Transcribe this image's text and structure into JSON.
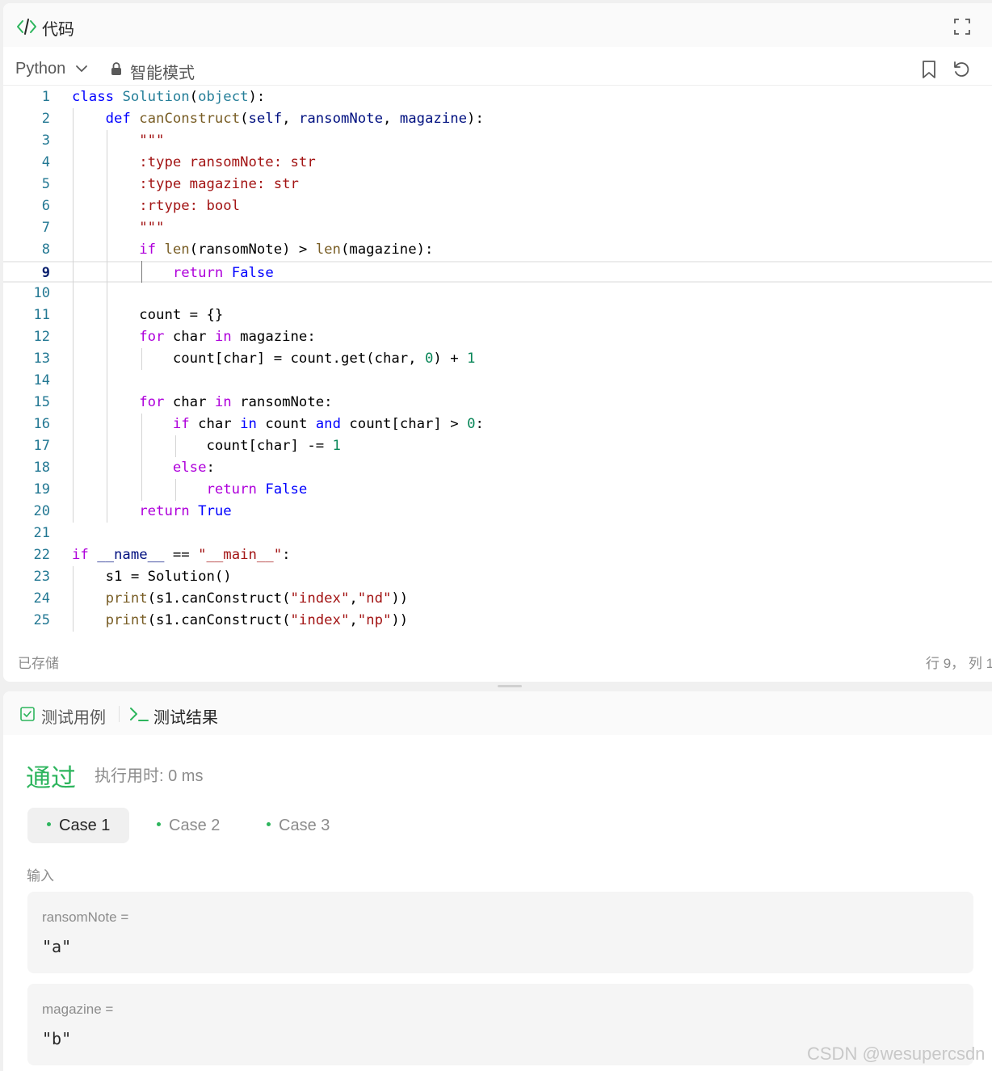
{
  "code_panel": {
    "title": "代码",
    "icon": "code-brackets-icon",
    "expand_icon": "fullscreen-icon",
    "language": "Python",
    "mode_label": "智能模式",
    "saved_label": "已存储",
    "cursor_label": "行 9， 列 1"
  },
  "editor": {
    "current_line": 9,
    "lines": [
      {
        "n": "1",
        "indent": 0,
        "tokens": [
          {
            "t": "class",
            "c": "kw"
          },
          {
            "t": " "
          },
          {
            "t": "Solution",
            "c": "cls"
          },
          {
            "t": "("
          },
          {
            "t": "object",
            "c": "cls"
          },
          {
            "t": "):"
          }
        ]
      },
      {
        "n": "2",
        "indent": 1,
        "tokens": [
          {
            "t": "def",
            "c": "kw"
          },
          {
            "t": " "
          },
          {
            "t": "canConstruct",
            "c": "fn"
          },
          {
            "t": "("
          },
          {
            "t": "self",
            "c": "prm"
          },
          {
            "t": ", "
          },
          {
            "t": "ransomNote",
            "c": "prm"
          },
          {
            "t": ", "
          },
          {
            "t": "magazine",
            "c": "prm"
          },
          {
            "t": "):"
          }
        ]
      },
      {
        "n": "3",
        "indent": 2,
        "tokens": [
          {
            "t": "\"\"\"",
            "c": "str"
          }
        ]
      },
      {
        "n": "4",
        "indent": 2,
        "tokens": [
          {
            "t": ":type ransomNote: str",
            "c": "str"
          }
        ]
      },
      {
        "n": "5",
        "indent": 2,
        "tokens": [
          {
            "t": ":type magazine: str",
            "c": "str"
          }
        ]
      },
      {
        "n": "6",
        "indent": 2,
        "tokens": [
          {
            "t": ":rtype: bool",
            "c": "str"
          }
        ]
      },
      {
        "n": "7",
        "indent": 2,
        "tokens": [
          {
            "t": "\"\"\"",
            "c": "str"
          }
        ]
      },
      {
        "n": "8",
        "indent": 2,
        "tokens": [
          {
            "t": "if",
            "c": "ctl"
          },
          {
            "t": " "
          },
          {
            "t": "len",
            "c": "fn"
          },
          {
            "t": "(ransomNote) > "
          },
          {
            "t": "len",
            "c": "fn"
          },
          {
            "t": "(magazine):"
          }
        ]
      },
      {
        "n": "9",
        "indent": 3,
        "tokens": [
          {
            "t": "return",
            "c": "ctl"
          },
          {
            "t": " "
          },
          {
            "t": "False",
            "c": "kw"
          }
        ]
      },
      {
        "n": "10",
        "indent": 0,
        "tokens": []
      },
      {
        "n": "11",
        "indent": 2,
        "tokens": [
          {
            "t": "count = {}"
          }
        ]
      },
      {
        "n": "12",
        "indent": 2,
        "tokens": [
          {
            "t": "for",
            "c": "ctl"
          },
          {
            "t": " char "
          },
          {
            "t": "in",
            "c": "ctl"
          },
          {
            "t": " magazine:"
          }
        ]
      },
      {
        "n": "13",
        "indent": 3,
        "tokens": [
          {
            "t": "count[char] = count.get(char, "
          },
          {
            "t": "0",
            "c": "num"
          },
          {
            "t": ") + "
          },
          {
            "t": "1",
            "c": "num"
          }
        ]
      },
      {
        "n": "14",
        "indent": 0,
        "tokens": []
      },
      {
        "n": "15",
        "indent": 2,
        "tokens": [
          {
            "t": "for",
            "c": "ctl"
          },
          {
            "t": " char "
          },
          {
            "t": "in",
            "c": "ctl"
          },
          {
            "t": " ransomNote:"
          }
        ]
      },
      {
        "n": "16",
        "indent": 3,
        "tokens": [
          {
            "t": "if",
            "c": "ctl"
          },
          {
            "t": " char "
          },
          {
            "t": "in",
            "c": "kw"
          },
          {
            "t": " count "
          },
          {
            "t": "and",
            "c": "kw"
          },
          {
            "t": " count[char] > "
          },
          {
            "t": "0",
            "c": "num"
          },
          {
            "t": ":"
          }
        ]
      },
      {
        "n": "17",
        "indent": 4,
        "tokens": [
          {
            "t": "count[char] -= "
          },
          {
            "t": "1",
            "c": "num"
          }
        ]
      },
      {
        "n": "18",
        "indent": 3,
        "tokens": [
          {
            "t": "else",
            "c": "ctl"
          },
          {
            "t": ":"
          }
        ]
      },
      {
        "n": "19",
        "indent": 4,
        "tokens": [
          {
            "t": "return",
            "c": "ctl"
          },
          {
            "t": " "
          },
          {
            "t": "False",
            "c": "kw"
          }
        ]
      },
      {
        "n": "20",
        "indent": 2,
        "tokens": [
          {
            "t": "return",
            "c": "ctl"
          },
          {
            "t": " "
          },
          {
            "t": "True",
            "c": "kw"
          }
        ]
      },
      {
        "n": "21",
        "indent": 0,
        "tokens": []
      },
      {
        "n": "22",
        "indent": 0,
        "tokens": [
          {
            "t": "if",
            "c": "ctl"
          },
          {
            "t": " "
          },
          {
            "t": "__name__",
            "c": "prm"
          },
          {
            "t": " == "
          },
          {
            "t": "\"__main__\"",
            "c": "str"
          },
          {
            "t": ":"
          }
        ]
      },
      {
        "n": "23",
        "indent": 1,
        "tokens": [
          {
            "t": "s1 = Solution()"
          }
        ]
      },
      {
        "n": "24",
        "indent": 1,
        "tokens": [
          {
            "t": "print",
            "c": "fn"
          },
          {
            "t": "(s1.canConstruct("
          },
          {
            "t": "\"index\"",
            "c": "str"
          },
          {
            "t": ","
          },
          {
            "t": "\"nd\"",
            "c": "str"
          },
          {
            "t": "))"
          }
        ]
      },
      {
        "n": "25",
        "indent": 1,
        "tokens": [
          {
            "t": "print",
            "c": "fn"
          },
          {
            "t": "(s1.canConstruct("
          },
          {
            "t": "\"index\"",
            "c": "str"
          },
          {
            "t": ","
          },
          {
            "t": "\"np\"",
            "c": "str"
          },
          {
            "t": "))"
          }
        ]
      }
    ]
  },
  "toolbar": {
    "lock_icon": "lock-icon",
    "bookmark_icon": "bookmark-icon",
    "reset_icon": "reset-icon"
  },
  "result_panel": {
    "tab_testcases": "测试用例",
    "tab_results": "测试结果",
    "status": "通过",
    "runtime": "执行用时: 0 ms",
    "cases": [
      "Case 1",
      "Case 2",
      "Case 3"
    ],
    "active_case": 0,
    "input_label": "输入",
    "params": [
      {
        "name": "ransomNote =",
        "value": "\"a\""
      },
      {
        "name": "magazine =",
        "value": "\"b\""
      }
    ],
    "status_color": "#2db55d"
  },
  "watermark": "CSDN @wesupercsdn"
}
